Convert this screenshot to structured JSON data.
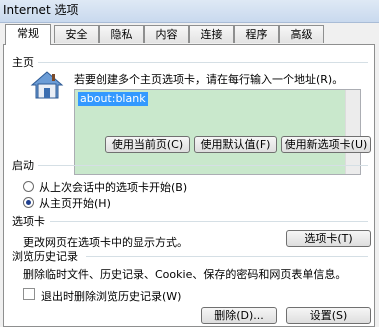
{
  "window": {
    "title": "Internet 选项"
  },
  "tabs": [
    "常规",
    "安全",
    "隐私",
    "内容",
    "连接",
    "程序",
    "高级"
  ],
  "home": {
    "group_label": "主页",
    "description": "若要创建多个主页选项卡，请在每行输入一个地址(R)。",
    "address_value": "about:blank",
    "buttons": [
      "使用当前页(C)",
      "使用默认值(F)",
      "使用新选项卡(U)"
    ]
  },
  "startup": {
    "group_label": "启动",
    "options": [
      {
        "label": "从上次会话中的选项卡开始(B)",
        "selected": false
      },
      {
        "label": "从主页开始(H)",
        "selected": true
      }
    ]
  },
  "tabs_section": {
    "group_label": "选项卡",
    "description": "更改网页在选项卡中的显示方式。",
    "button": "选项卡(T)"
  },
  "history": {
    "group_label": "浏览历史记录",
    "description": "删除临时文件、历史记录、Cookie、保存的密码和网页表单信息。",
    "checkbox_label": "退出时删除浏览历史记录(W)",
    "checkbox_checked": false,
    "delete_button": "删除(D)...",
    "settings_button": "设置(S)"
  },
  "colors": {
    "address_bg": "#c9e8cc",
    "selection": "#3399ff"
  },
  "icons": {
    "home": "house-icon"
  }
}
